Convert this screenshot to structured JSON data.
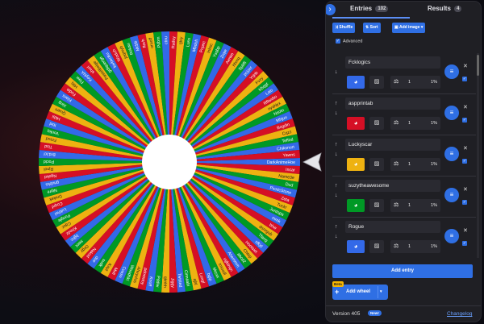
{
  "wheel": {
    "segment_colors": [
      "#3369e8",
      "#d50f25",
      "#eeb211",
      "#009925"
    ],
    "labels": [
      "DarkAnimeHoe",
      "Incar",
      "Name3e",
      "Dud",
      "PicnicStone",
      "Zeta",
      "Tuckr",
      "Juntopa",
      "mmk",
      "bhw",
      "dsnrgub",
      "Tfang",
      "sfkjd",
      "Hootsiet",
      "Chtsp",
      "abcd2",
      "Ahemmm",
      "ugbtnqn",
      "tmoodl",
      "Mrzxx",
      "bglp",
      "Lungl",
      "ajhl",
      "Cinnaabi",
      "Twisted",
      "Jiggy",
      "qknhh",
      "Pddiw",
      "Knoff",
      "pdmtntoy",
      "Ahvyvlos",
      "Woodhkl",
      "Coaso",
      "Mxfl",
      "Kayt",
      "sudk",
      "doe",
      "Nakod",
      "Orgy",
      "swot",
      "bjjhc",
      "Khodz",
      "Cquz",
      "Pongle",
      "Lukhel",
      "Coqnf",
      "Dmkek",
      "Nipre",
      "gnubks",
      "Ngokd",
      "Rjnol",
      "Pocid",
      "BrdJcl",
      "Tisd",
      "Fmud",
      "Vonkq",
      "Ibid",
      "Hkbi",
      "Quam",
      "Xing",
      "Klaxs",
      "Fodie",
      "Hilq",
      "Flaw",
      "KeyNA",
      "shurl",
      "PastelBeige",
      "gdiquerge",
      "luvbeoku",
      "Woduh",
      "joqmyb",
      "Rokau",
      "Mcbb",
      "flavh",
      "oruoff",
      "Pdbm",
      "ctnu",
      "Raduy",
      "tjbiy",
      "Luns",
      "Mbdoh",
      "Pcpnc",
      "Inbsc",
      "Ysqbp",
      "Zrqw",
      "Aenim",
      "hhmq",
      "Spliffi",
      "pcjzer",
      "Yrjnb",
      "Fvxy",
      "Kbqgt",
      "Lalo",
      "Rflwxbo",
      "nyaNyx",
      "Nsotn",
      "Mhjuu",
      "Bogdin",
      "Cqzz",
      "Teffod",
      "Chiksnurt",
      "Yawns"
    ]
  },
  "panel": {
    "collapse_icon": "chevron-right",
    "tabs": {
      "entries_label": "Entries",
      "entries_count": "102",
      "results_label": "Results",
      "results_count": "4"
    },
    "toolbar": {
      "shuffle_label": "Shuffle",
      "sort_label": "Sort",
      "add_image_label": "Add image"
    },
    "advanced_label": "Advanced",
    "entries": [
      {
        "name": "Fcklogics",
        "color": "#3369e8",
        "weight": "1",
        "percent": "1%",
        "up": false
      },
      {
        "name": "aspprintab",
        "color": "#d50f25",
        "weight": "1",
        "percent": "1%",
        "up": true
      },
      {
        "name": "Luckyscar",
        "color": "#eeb211",
        "weight": "1",
        "percent": "1%",
        "up": true
      },
      {
        "name": "suzytheawesome",
        "color": "#009925",
        "weight": "1",
        "percent": "1%",
        "up": true
      },
      {
        "name": "Rogue",
        "color": "#3369e8",
        "weight": "1",
        "percent": "1%",
        "up": true
      }
    ],
    "add_entry_label": "Add entry",
    "beta_label": "Beta",
    "add_wheel_label": "Add wheel",
    "version_label": "Version 405",
    "new_label": "New!",
    "changelog_label": "Changelog"
  }
}
